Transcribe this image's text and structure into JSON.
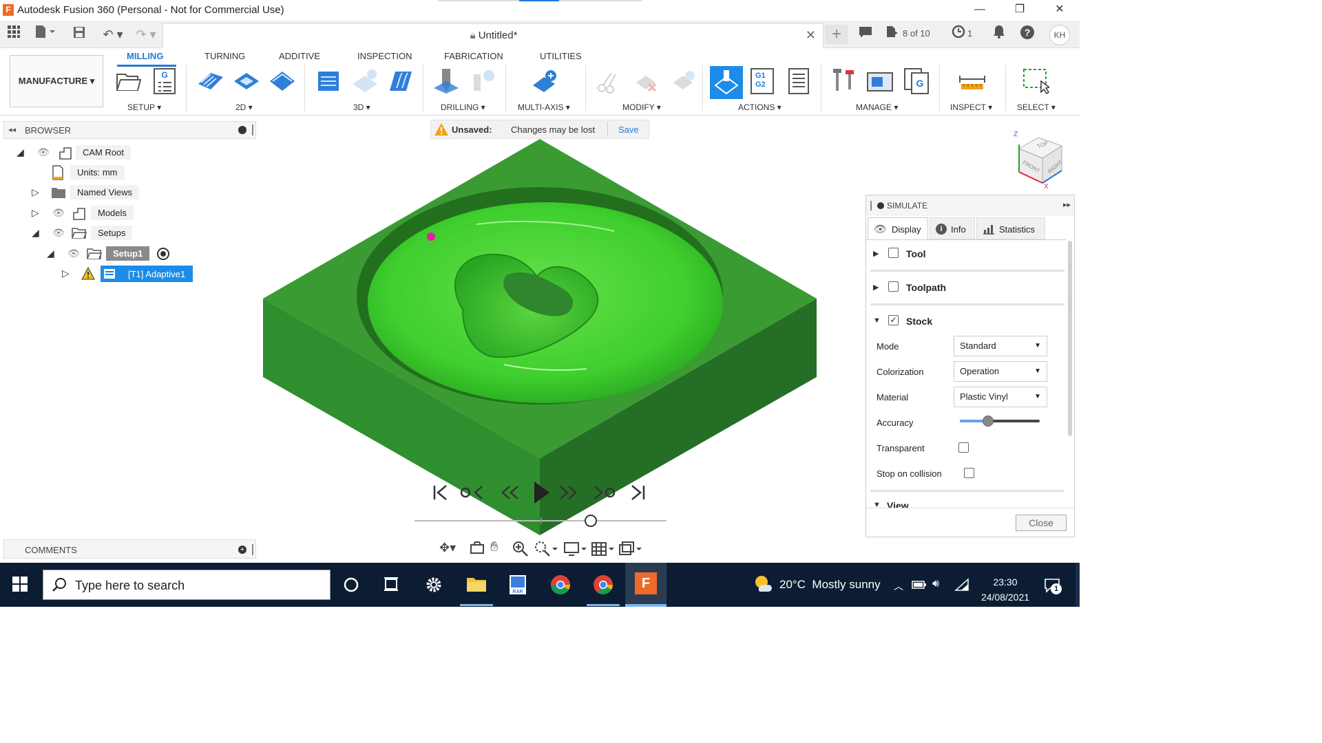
{
  "window": {
    "title": "Autodesk Fusion 360 (Personal - Not for Commercial Use)",
    "app_icon_letter": "F"
  },
  "appbar": {
    "doc_title": "Untitled*",
    "jobs": "8 of 10",
    "clock_count": "1",
    "user_initials": "KH"
  },
  "ribbon": {
    "tabs": [
      "MILLING",
      "TURNING",
      "ADDITIVE",
      "INSPECTION",
      "FABRICATION",
      "UTILITIES"
    ],
    "active_tab": "MILLING",
    "workspace": "MANUFACTURE ▾",
    "groups": [
      "SETUP ▾",
      "2D ▾",
      "3D ▾",
      "DRILLING ▾",
      "MULTI-AXIS ▾",
      "MODIFY ▾",
      "ACTIONS ▾",
      "MANAGE ▾",
      "INSPECT ▾",
      "SELECT ▾"
    ],
    "g1g2": [
      "G1",
      "G2"
    ]
  },
  "browser": {
    "title": "BROWSER",
    "items": [
      {
        "label": "CAM Root"
      },
      {
        "label": "Units: mm"
      },
      {
        "label": "Named Views"
      },
      {
        "label": "Models"
      },
      {
        "label": "Setups"
      },
      {
        "label": "Setup1"
      },
      {
        "label": "[T1] Adaptive1"
      }
    ]
  },
  "notice": {
    "label": "Unsaved:",
    "message": "Changes may be lost",
    "action": "Save"
  },
  "simulate": {
    "title": "SIMULATE",
    "tabs": [
      "Display",
      "Info",
      "Statistics"
    ],
    "sections": {
      "tool": "Tool",
      "toolpath": "Toolpath",
      "stock": "Stock",
      "view": "View"
    },
    "rows": {
      "mode": {
        "label": "Mode",
        "value": "Standard"
      },
      "colorization": {
        "label": "Colorization",
        "value": "Operation"
      },
      "material": {
        "label": "Material",
        "value": "Plastic Vinyl"
      },
      "accuracy": {
        "label": "Accuracy",
        "level": 0.35
      },
      "transparent": {
        "label": "Transparent"
      },
      "stop": {
        "label": "Stop on collision"
      }
    },
    "close": "Close"
  },
  "comments": {
    "title": "COMMENTS"
  },
  "viewcube": {
    "faces": [
      "TOP",
      "FRONT",
      "RIGHT"
    ],
    "axes": [
      "Z",
      "X"
    ]
  },
  "playback": {
    "progress": 0.7
  },
  "taskbar": {
    "search_placeholder": "Type here to search",
    "weather": "20°C  Mostly sunny",
    "time": "23:30",
    "date": "24/08/2021",
    "notif_count": "1"
  },
  "colors": {
    "accent": "#1d7bd9",
    "stock_top": "#3aa83a",
    "stock_side_left": "#2e8b2e",
    "stock_side_right": "#236e23",
    "taskbar": "#0c1d33"
  }
}
